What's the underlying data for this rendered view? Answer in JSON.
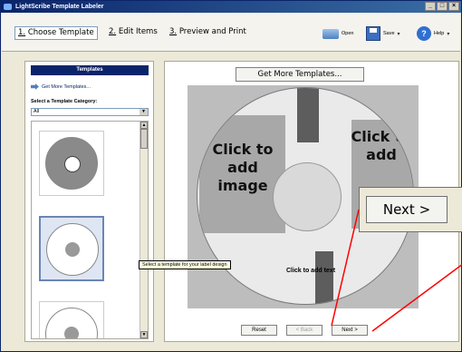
{
  "window": {
    "title": "LightScribe Template Labeler",
    "controls": [
      "_",
      "□",
      "×"
    ]
  },
  "toolbar": {
    "steps": [
      {
        "num": "1.",
        "label": "Choose Template"
      },
      {
        "num": "2.",
        "label": "Edit Items"
      },
      {
        "num": "3.",
        "label": "Preview and Print"
      }
    ],
    "open_label": "Open",
    "save_label": "Save",
    "help_label": "Help"
  },
  "left_panel": {
    "header": "Templates",
    "get_more_link": "Get More Templates...",
    "category_label": "Select a Template Category:",
    "category_value": "All"
  },
  "right_panel": {
    "get_more_button": "Get More Templates...",
    "preview": {
      "left_text": "Click to add image",
      "right_text": "Click to add",
      "bottom_text": "Click to add text"
    },
    "tooltip": "Select a template for your label design",
    "zoom_next_label": "Next >"
  },
  "nav": {
    "reset": "Reset",
    "back": "< Back",
    "next": "Next >"
  }
}
